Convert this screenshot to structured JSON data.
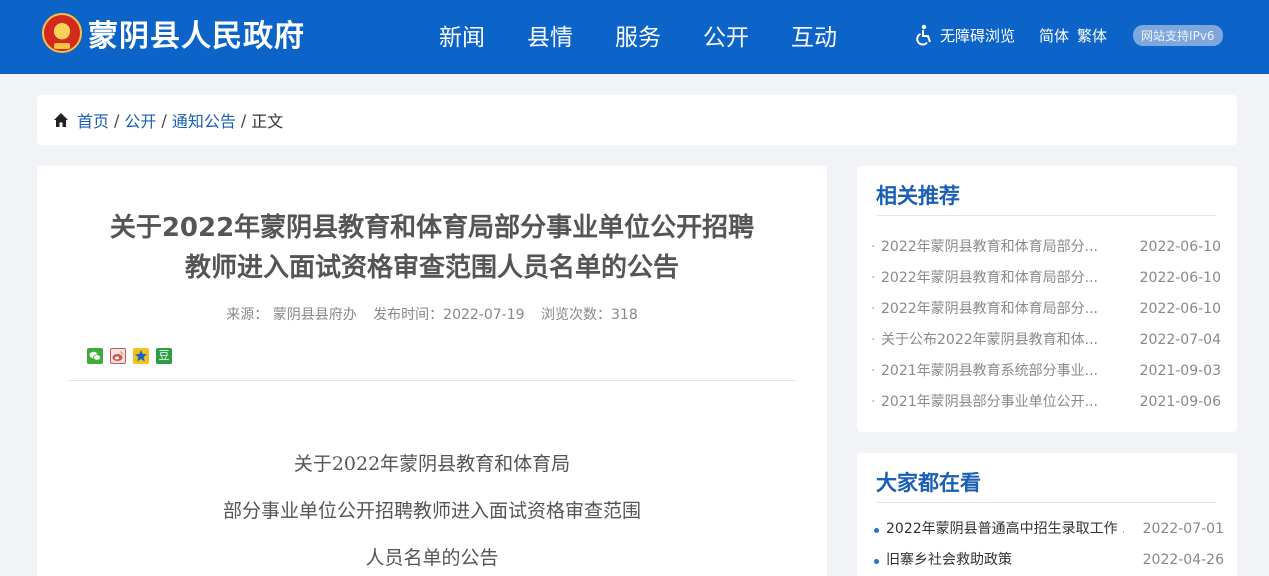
{
  "header": {
    "site_title": "蒙阴县人民政府",
    "nav": [
      "新闻",
      "县情",
      "服务",
      "公开",
      "互动"
    ],
    "accessibility_label": "无障碍浏览",
    "lang_simplified": "简体",
    "lang_traditional": "繁体",
    "ipv6_badge": "网站支持IPv6"
  },
  "breadcrumb": {
    "home": "首页",
    "section": "公开",
    "category": "通知公告",
    "current": "正文",
    "separator": "/"
  },
  "article": {
    "title_line1": "关于2022年蒙阴县教育和体育局部分事业单位公开招聘",
    "title_line2": "教师进入面试资格审查范围人员名单的公告",
    "source": "来源： 蒙阴县县府办",
    "publish_time": "发布时间：2022-07-19",
    "views": "浏览次数：318",
    "share": {
      "douban": "豆"
    },
    "body": [
      "关于2022年蒙阴县教育和体育局",
      "部分事业单位公开招聘教师进入面试资格审查范围",
      "人员名单的公告"
    ]
  },
  "related": {
    "title": "相关推荐",
    "items": [
      {
        "title": "2022年蒙阴县教育和体育局部分...",
        "date": "2022-06-10"
      },
      {
        "title": "2022年蒙阴县教育和体育局部分...",
        "date": "2022-06-10"
      },
      {
        "title": "2022年蒙阴县教育和体育局部分...",
        "date": "2022-06-10"
      },
      {
        "title": "关于公布2022年蒙阴县教育和体...",
        "date": "2022-07-04"
      },
      {
        "title": "2021年蒙阴县教育系统部分事业...",
        "date": "2021-09-03"
      },
      {
        "title": "2021年蒙阴县部分事业单位公开...",
        "date": "2021-09-06"
      }
    ]
  },
  "popular": {
    "title": "大家都在看",
    "items": [
      {
        "title": "2022年蒙阴县普通高中招生录取工作 ...",
        "date": "2022-07-01"
      },
      {
        "title": "旧寨乡社会救助政策",
        "date": "2022-04-26"
      }
    ]
  },
  "colors": {
    "header_bg": "#0d64c8",
    "link": "#1a5fb4",
    "page_bg": "#f1f3f6"
  },
  "icons": [
    "national-emblem",
    "accessibility-icon",
    "home-icon",
    "wechat-share-icon",
    "weibo-share-icon",
    "qzone-share-icon",
    "douban-share-icon"
  ]
}
